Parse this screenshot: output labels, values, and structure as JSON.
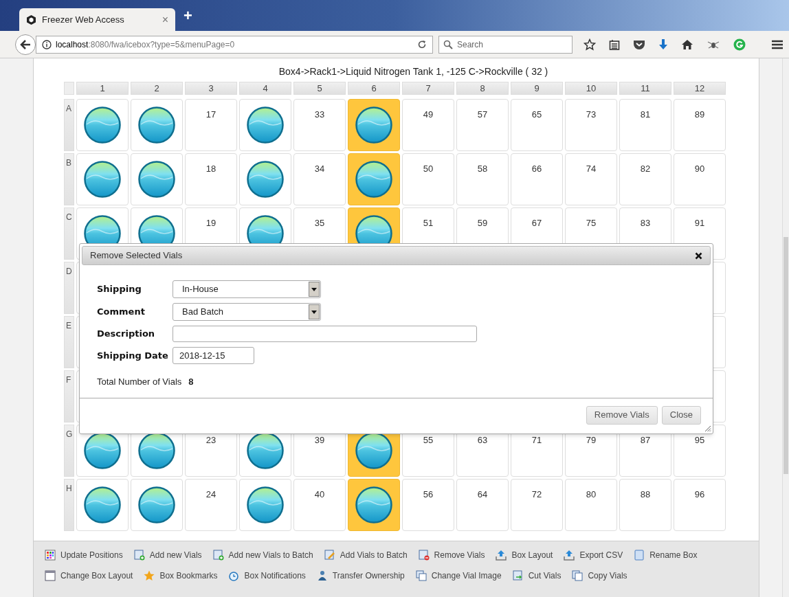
{
  "browser": {
    "tab_title": "Freezer Web Access",
    "tab_close": "×",
    "new_tab": "+",
    "url_host": "localhost",
    "url_path": ":8080/fwa/icebox?type=5&menuPage=0",
    "search_placeholder": "Search"
  },
  "box": {
    "title": "Box4->Rack1->Liquid Nitrogen Tank 1, -125 C->Rockville ( 32 )",
    "columns": [
      "1",
      "2",
      "3",
      "4",
      "5",
      "6",
      "7",
      "8",
      "9",
      "10",
      "11",
      "12"
    ],
    "rows": [
      {
        "label": "A",
        "cells": [
          {
            "kind": "vial",
            "selected": false
          },
          {
            "kind": "vial",
            "selected": false
          },
          {
            "kind": "empty",
            "number": "17",
            "selected": false
          },
          {
            "kind": "vial",
            "selected": false
          },
          {
            "kind": "empty",
            "number": "33",
            "selected": false
          },
          {
            "kind": "vial",
            "selected": true
          },
          {
            "kind": "empty",
            "number": "49",
            "selected": false
          },
          {
            "kind": "empty",
            "number": "57",
            "selected": false
          },
          {
            "kind": "empty",
            "number": "65",
            "selected": false
          },
          {
            "kind": "empty",
            "number": "73",
            "selected": false
          },
          {
            "kind": "empty",
            "number": "81",
            "selected": false
          },
          {
            "kind": "empty",
            "number": "89",
            "selected": false
          }
        ]
      },
      {
        "label": "B",
        "cells": [
          {
            "kind": "vial",
            "selected": false
          },
          {
            "kind": "vial",
            "selected": false
          },
          {
            "kind": "empty",
            "number": "18",
            "selected": false
          },
          {
            "kind": "vial",
            "selected": false
          },
          {
            "kind": "empty",
            "number": "34",
            "selected": false
          },
          {
            "kind": "vial",
            "selected": true
          },
          {
            "kind": "empty",
            "number": "50",
            "selected": false
          },
          {
            "kind": "empty",
            "number": "58",
            "selected": false
          },
          {
            "kind": "empty",
            "number": "66",
            "selected": false
          },
          {
            "kind": "empty",
            "number": "74",
            "selected": false
          },
          {
            "kind": "empty",
            "number": "82",
            "selected": false
          },
          {
            "kind": "empty",
            "number": "90",
            "selected": false
          }
        ]
      },
      {
        "label": "C",
        "cells": [
          {
            "kind": "vial",
            "selected": false
          },
          {
            "kind": "vial",
            "selected": false
          },
          {
            "kind": "empty",
            "number": "19",
            "selected": false
          },
          {
            "kind": "vial",
            "selected": false
          },
          {
            "kind": "empty",
            "number": "35",
            "selected": false
          },
          {
            "kind": "vial",
            "selected": true
          },
          {
            "kind": "empty",
            "number": "51",
            "selected": false
          },
          {
            "kind": "empty",
            "number": "59",
            "selected": false
          },
          {
            "kind": "empty",
            "number": "67",
            "selected": false
          },
          {
            "kind": "empty",
            "number": "75",
            "selected": false
          },
          {
            "kind": "empty",
            "number": "83",
            "selected": false
          },
          {
            "kind": "empty",
            "number": "91",
            "selected": false
          }
        ]
      },
      {
        "label": "D"
      },
      {
        "label": "E"
      },
      {
        "label": "F"
      },
      {
        "label": "G",
        "cells": [
          {
            "kind": "vial",
            "selected": false
          },
          {
            "kind": "vial",
            "selected": false
          },
          {
            "kind": "empty",
            "number": "23",
            "selected": false
          },
          {
            "kind": "vial",
            "selected": false
          },
          {
            "kind": "empty",
            "number": "39",
            "selected": false
          },
          {
            "kind": "vial",
            "selected": true
          },
          {
            "kind": "empty",
            "number": "55",
            "selected": false
          },
          {
            "kind": "empty",
            "number": "63",
            "selected": false
          },
          {
            "kind": "empty",
            "number": "71",
            "selected": false
          },
          {
            "kind": "empty",
            "number": "79",
            "selected": false
          },
          {
            "kind": "empty",
            "number": "87",
            "selected": false
          },
          {
            "kind": "empty",
            "number": "95",
            "selected": false
          }
        ]
      },
      {
        "label": "H",
        "cells": [
          {
            "kind": "vial",
            "selected": false
          },
          {
            "kind": "vial",
            "selected": false
          },
          {
            "kind": "empty",
            "number": "24",
            "selected": false
          },
          {
            "kind": "vial",
            "selected": false
          },
          {
            "kind": "empty",
            "number": "40",
            "selected": false
          },
          {
            "kind": "vial",
            "selected": true
          },
          {
            "kind": "empty",
            "number": "56",
            "selected": false
          },
          {
            "kind": "empty",
            "number": "64",
            "selected": false
          },
          {
            "kind": "empty",
            "number": "72",
            "selected": false
          },
          {
            "kind": "empty",
            "number": "80",
            "selected": false
          },
          {
            "kind": "empty",
            "number": "88",
            "selected": false
          },
          {
            "kind": "empty",
            "number": "96",
            "selected": false
          }
        ]
      }
    ]
  },
  "dialog": {
    "title": "Remove Selected Vials",
    "fields": [
      {
        "label": "Shipping",
        "kind": "select",
        "value": "In-House"
      },
      {
        "label": "Comment",
        "kind": "select",
        "value": "Bad Batch"
      },
      {
        "label": "Description",
        "kind": "text"
      },
      {
        "label": "Shipping Date",
        "kind": "date",
        "value": "2018-12-15"
      }
    ],
    "total_label": "Total Number of Vials",
    "total_value": "8",
    "buttons": [
      "Remove Vials",
      "Close"
    ]
  },
  "toolbar": [
    {
      "label": "Update Positions"
    },
    {
      "label": "Add new Vials"
    },
    {
      "label": "Add new Vials to Batch"
    },
    {
      "label": "Add Vials to Batch"
    },
    {
      "label": "Remove Vials"
    },
    {
      "label": "Box Layout"
    },
    {
      "label": "Export CSV"
    },
    {
      "label": "Rename Box"
    },
    {
      "label": "Change Box Layout"
    },
    {
      "label": "Box Bookmarks"
    },
    {
      "label": "Box Notifications"
    },
    {
      "label": "Transfer Ownership"
    },
    {
      "label": "Change Vial Image"
    },
    {
      "label": "Cut Vials"
    },
    {
      "label": "Copy Vials"
    }
  ]
}
